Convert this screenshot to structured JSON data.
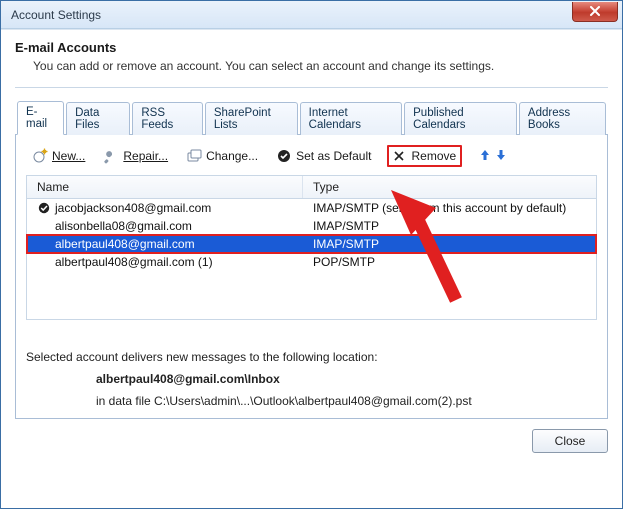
{
  "window": {
    "title": "Account Settings"
  },
  "header": {
    "title": "E-mail Accounts",
    "subtitle": "You can add or remove an account. You can select an account and change its settings."
  },
  "tabs": [
    {
      "label": "E-mail",
      "active": true
    },
    {
      "label": "Data Files",
      "active": false
    },
    {
      "label": "RSS Feeds",
      "active": false
    },
    {
      "label": "SharePoint Lists",
      "active": false
    },
    {
      "label": "Internet Calendars",
      "active": false
    },
    {
      "label": "Published Calendars",
      "active": false
    },
    {
      "label": "Address Books",
      "active": false
    }
  ],
  "toolbar": {
    "new": "New...",
    "repair": "Repair...",
    "change": "Change...",
    "set_default": "Set as Default",
    "remove": "Remove"
  },
  "columns": {
    "name": "Name",
    "type": "Type"
  },
  "accounts": [
    {
      "name": "jacobjackson408@gmail.com",
      "type": "IMAP/SMTP (send from this account by default)",
      "default": true,
      "selected": false
    },
    {
      "name": "alisonbella08@gmail.com",
      "type": "IMAP/SMTP",
      "default": false,
      "selected": false
    },
    {
      "name": "albertpaul408@gmail.com",
      "type": "IMAP/SMTP",
      "default": false,
      "selected": true
    },
    {
      "name": "albertpaul408@gmail.com (1)",
      "type": "POP/SMTP",
      "default": false,
      "selected": false
    }
  ],
  "delivery": {
    "intro": "Selected account delivers new messages to the following location:",
    "mailbox": "albertpaul408@gmail.com",
    "folder": "\\Inbox",
    "datafile_prefix": "in data file ",
    "datafile_path": "C:\\Users\\admin\\...\\Outlook\\albertpaul408@gmail.com(2).pst"
  },
  "buttons": {
    "close": "Close"
  }
}
